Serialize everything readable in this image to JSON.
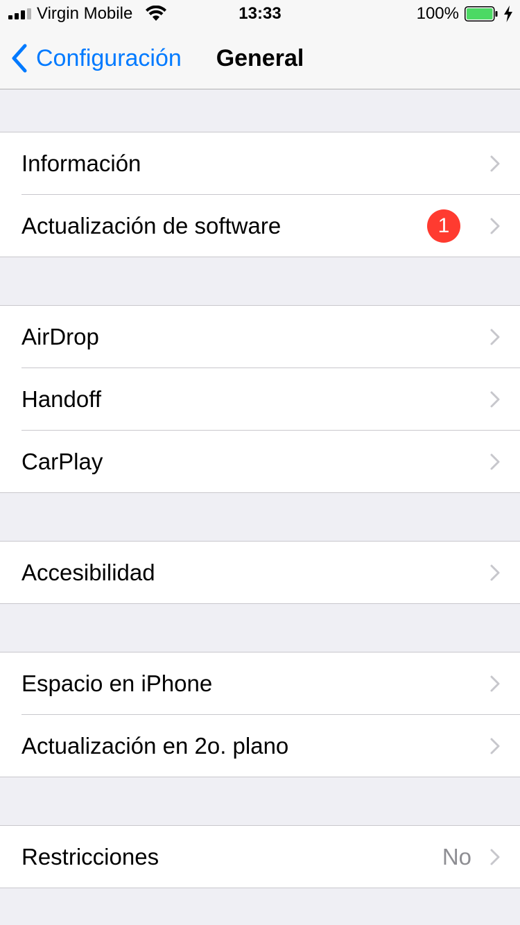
{
  "status_bar": {
    "carrier": "Virgin Mobile",
    "time": "13:33",
    "battery_percent": "100%",
    "battery_level": 1.0,
    "signal_bars": 4,
    "icons": [
      "signal-icon",
      "wifi-icon",
      "battery-icon",
      "charging-icon"
    ]
  },
  "nav": {
    "back_label": "Configuración",
    "title": "General"
  },
  "colors": {
    "accent": "#007aff",
    "badge": "#ff3b30",
    "background": "#efeff4",
    "battery": "#4cd964",
    "secondary_text": "#8e8e93"
  },
  "groups": [
    {
      "rows": [
        {
          "label": "Información"
        },
        {
          "label": "Actualización de software",
          "badge": "1"
        }
      ]
    },
    {
      "rows": [
        {
          "label": "AirDrop"
        },
        {
          "label": "Handoff"
        },
        {
          "label": "CarPlay"
        }
      ]
    },
    {
      "rows": [
        {
          "label": "Accesibilidad"
        }
      ]
    },
    {
      "rows": [
        {
          "label": "Espacio en iPhone"
        },
        {
          "label": "Actualización en 2o. plano"
        }
      ]
    },
    {
      "rows": [
        {
          "label": "Restricciones",
          "value": "No"
        }
      ]
    }
  ]
}
